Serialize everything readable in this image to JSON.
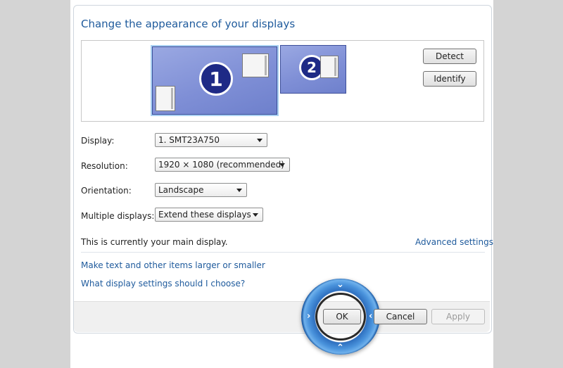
{
  "title": "Change the appearance of your displays",
  "monitors": {
    "primary_number": "1",
    "secondary_number": "2"
  },
  "buttons": {
    "detect": "Detect",
    "identify": "Identify",
    "ok": "OK",
    "cancel": "Cancel",
    "apply": "Apply"
  },
  "fields": {
    "display": {
      "label": "Display:",
      "value": "1. SMT23A750"
    },
    "resolution": {
      "label": "Resolution:",
      "value": "1920 × 1080 (recommended)"
    },
    "orientation": {
      "label": "Orientation:",
      "value": "Landscape"
    },
    "multiple": {
      "label": "Multiple displays:",
      "value": "Extend these displays"
    }
  },
  "status": "This is currently your main display.",
  "links": {
    "advanced": "Advanced settings",
    "text_size": "Make text and other items larger or smaller",
    "help": "What display settings should I choose?"
  },
  "colors": {
    "link": "#1e5a9c",
    "monitor_fill": "#7f8fd6",
    "highlight_ring": "#2e6fbf"
  },
  "icons": {
    "ring_up": "chevron-up-icon",
    "ring_down": "chevron-down-icon",
    "ring_left": "chevron-left-icon",
    "ring_right": "chevron-right-icon"
  }
}
